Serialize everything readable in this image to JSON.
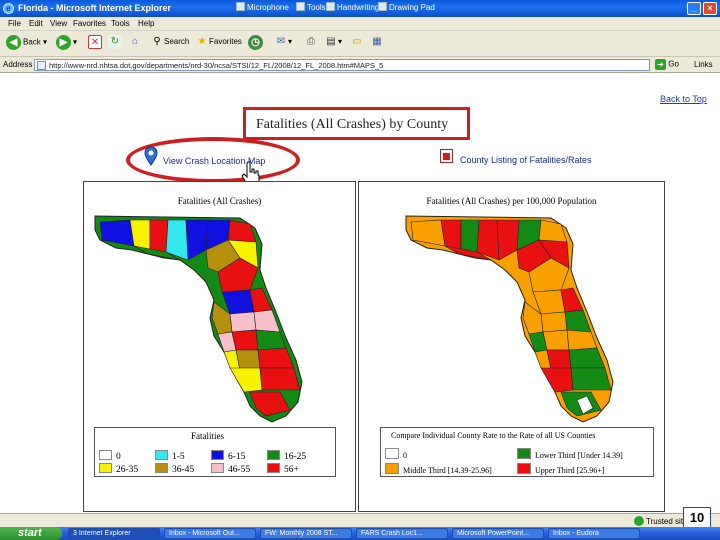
{
  "window": {
    "title": "Florida - Microsoft Internet Explorer",
    "quicklaunch": [
      "Microphone",
      "Tools",
      "Handwriting",
      "Drawing Pad"
    ]
  },
  "menu": [
    "File",
    "Edit",
    "View",
    "Favorites",
    "Tools",
    "Help"
  ],
  "toolbar": {
    "back": "Back",
    "search": "Search",
    "favorites": "Favorites"
  },
  "address": {
    "label": "Address",
    "url": "http://www-nrd.nhtsa.dot.gov/departments/nrd-30/ncsa/STSI/12_FL/2008/12_FL_2008.htm#MAPS_5",
    "go": "Go",
    "links": "Links"
  },
  "content": {
    "back_to_top": "Back to Top",
    "title": "Fatalities (All Crashes) by County",
    "crash_map_link": "View Crash Location Map",
    "county_listing_link": "County Listing of Fatalities/Rates"
  },
  "left_map": {
    "title": "Fatalities (All Crashes)",
    "legend_title": "Fatalities",
    "legend": [
      {
        "label": "0",
        "color": "#ffffff"
      },
      {
        "label": "1-5",
        "color": "#33e6f0"
      },
      {
        "label": "6-15",
        "color": "#1010e0"
      },
      {
        "label": "16-25",
        "color": "#138a13"
      },
      {
        "label": "26-35",
        "color": "#f7f200"
      },
      {
        "label": "36-45",
        "color": "#b5900f"
      },
      {
        "label": "46-55",
        "color": "#f7c0c8"
      },
      {
        "label": "56+",
        "color": "#e81010"
      }
    ]
  },
  "right_map": {
    "title": "Fatalities (All Crashes) per 100,000 Population",
    "legend_title": "Compare Individual County Rate to the Rate of all US Counties",
    "legend": [
      {
        "label": "0",
        "color": "#ffffff"
      },
      {
        "label": "Lower Third [Under 14.39]",
        "color": "#138a13"
      },
      {
        "label": "Middle Third [14.39-25.96]",
        "color": "#f7a000"
      },
      {
        "label": "Upper Third [25.96+]",
        "color": "#e81010"
      }
    ]
  },
  "status": {
    "trusted": "Trusted sites",
    "page_number": "10"
  },
  "taskbar": {
    "start": "start",
    "tasks": [
      "3 Internet Explorer",
      "Inbox - Microsoft Out...",
      "FW: Monthly 2008 ST...",
      "FARS Crash Loc1...",
      "Microsoft PowerPoint...",
      "Inbox - Eudora"
    ]
  }
}
